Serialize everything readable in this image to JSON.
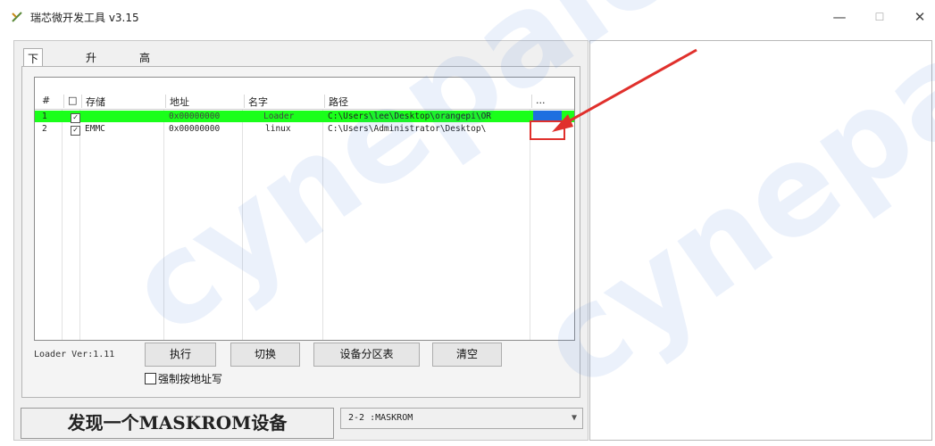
{
  "window": {
    "title": "瑞芯微开发工具 v3.15"
  },
  "icons": {
    "app": "rockchip-tool-icon",
    "minimize": "minimize-icon",
    "maximize": "maximize-icon",
    "close": "close-icon"
  },
  "tabs": [
    {
      "label": "下载镜像",
      "active": true
    },
    {
      "label": "升级固件"
    },
    {
      "label": "高级功能"
    }
  ],
  "table": {
    "headers": [
      "#",
      "□",
      "存储",
      "地址",
      "名字",
      "路径",
      "..."
    ],
    "rows": [
      {
        "num": "1",
        "checked": true,
        "storage": "",
        "address": "0x00000000",
        "name": "Loader",
        "path": "C:\\Users\\lee\\Desktop\\orangepi\\OR",
        "highlight": true
      },
      {
        "num": "2",
        "checked": true,
        "storage": "EMMC",
        "address": "0x00000000",
        "name": "linux",
        "path": "C:\\Users\\Administrator\\Desktop\\",
        "highlight": false
      }
    ]
  },
  "loader_version": "Loader Ver:1.11",
  "buttons": {
    "run": "执行",
    "switch": "切换",
    "device_partition": "设备分区表",
    "clear": "清空"
  },
  "force_write": {
    "label": "强制按地址写",
    "checked": false
  },
  "status": "发现一个MASKROM设备",
  "device_select": {
    "value": "2-2 :MASKROM"
  },
  "watermark": "cynepaic",
  "colors": {
    "highlight_row": "#1aff1a",
    "selected_cell": "#1e6fe0",
    "annotation": "#e0302c"
  }
}
